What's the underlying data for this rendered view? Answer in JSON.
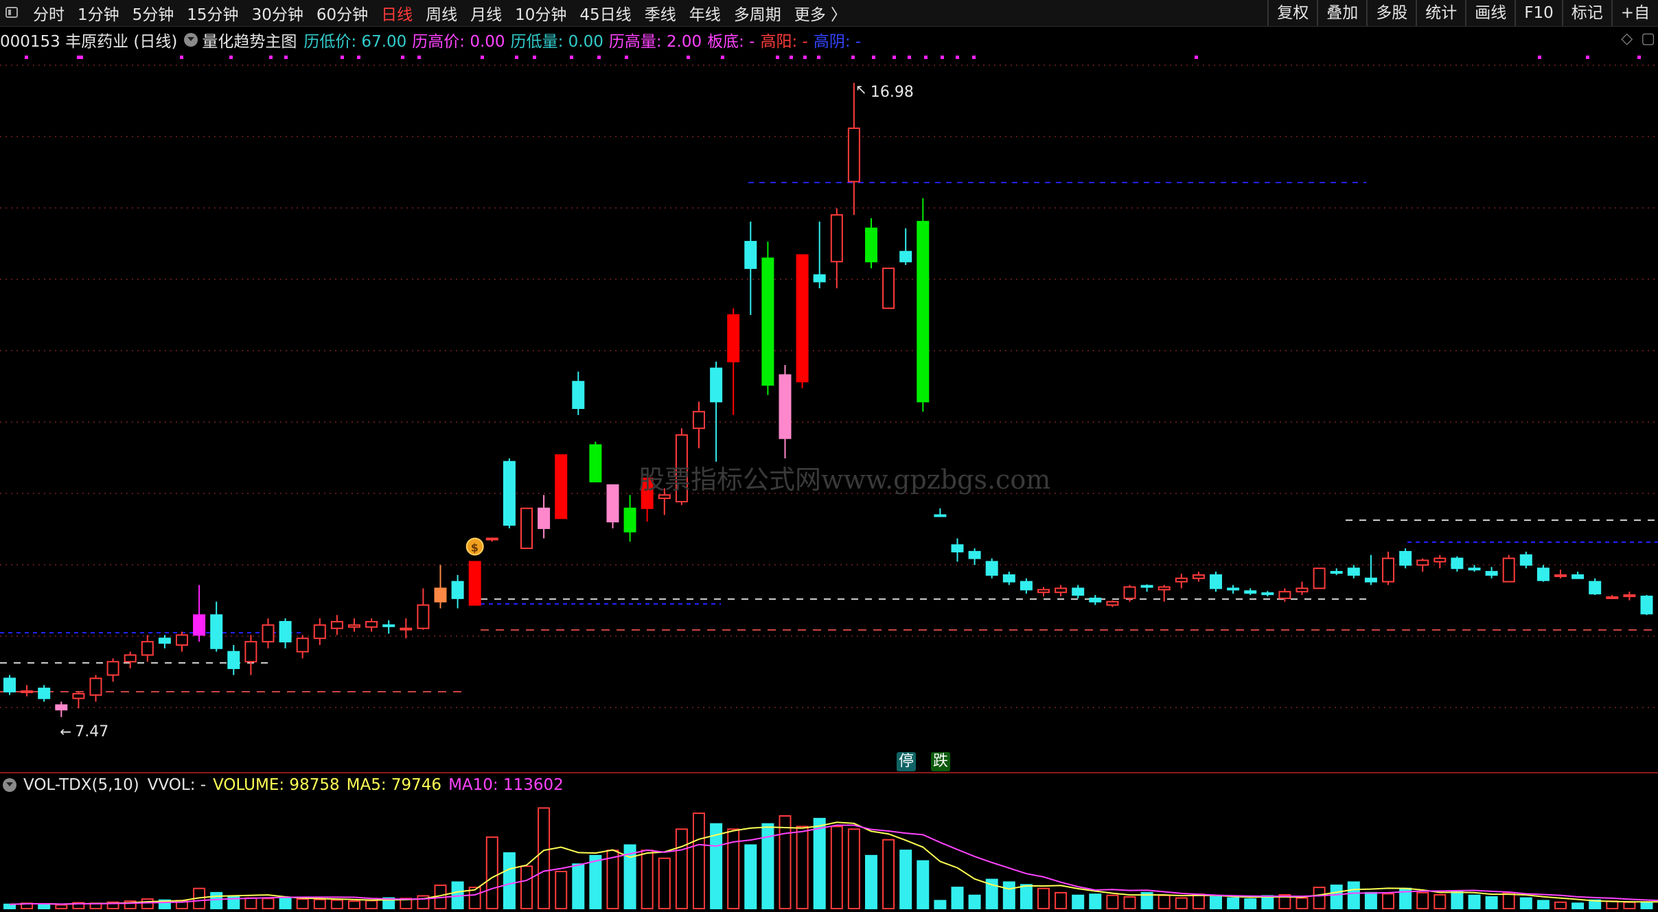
{
  "toolbar": {
    "periods": [
      "分时",
      "1分钟",
      "5分钟",
      "15分钟",
      "30分钟",
      "60分钟",
      "日线",
      "周线",
      "月线",
      "10分钟",
      "45日线",
      "季线",
      "年线",
      "多周期",
      "更多 〉"
    ],
    "active_period": "日线",
    "tools": [
      "复权",
      "叠加",
      "多股",
      "统计",
      "画线",
      "F10",
      "标记",
      "+自"
    ]
  },
  "info": {
    "code_name": "000153 丰原药业 (日线)",
    "indicator": "量化趋势主图",
    "fields": [
      {
        "label": "历低价: 67.00",
        "color": "#33cccc"
      },
      {
        "label": "历高价: 0.00",
        "color": "#ff44ff"
      },
      {
        "label": "历低量: 0.00",
        "color": "#33cccc"
      },
      {
        "label": "历高量: 2.00",
        "color": "#ff44ff"
      },
      {
        "label": "板底: -",
        "color": "#ff44ff"
      },
      {
        "label": "高阳: -",
        "color": "#ff3b3b"
      },
      {
        "label": "高阴: -",
        "color": "#3344ff"
      }
    ],
    "corner_icons": [
      "diamond-icon",
      "window-icon"
    ]
  },
  "price_labels": {
    "high": "16.98",
    "low": "7.47"
  },
  "tags": {
    "stop": "停",
    "down": "跌"
  },
  "watermark": "股票指标公式网www.gpzbgs.com",
  "volume": {
    "indicator": "VOL-TDX(5,10)",
    "vvol": "VVOL: -",
    "volume": "VOLUME: 98758",
    "ma5": "MA5: 79746",
    "ma10": "MA10: 113602"
  },
  "colors": {
    "up": "#ff3b3b",
    "down": "#33eeee",
    "strong_up": "#ff0000",
    "strong_down": "#00ee00",
    "pink": "#ff88cc",
    "ma5": "#ffff55",
    "ma10": "#ff44ff",
    "background": "#000000"
  },
  "chart_data": {
    "type": "candlestick",
    "price_range": [
      6.8,
      17.4
    ],
    "candles": [
      {
        "o": 8.05,
        "h": 8.1,
        "l": 7.8,
        "c": 7.85,
        "t": "down"
      },
      {
        "o": 7.85,
        "h": 7.95,
        "l": 7.78,
        "c": 7.86,
        "t": "up"
      },
      {
        "o": 7.9,
        "h": 7.95,
        "l": 7.7,
        "c": 7.75,
        "t": "down"
      },
      {
        "o": 7.58,
        "h": 7.7,
        "l": 7.47,
        "c": 7.65,
        "t": "pink"
      },
      {
        "o": 7.75,
        "h": 7.85,
        "l": 7.6,
        "c": 7.82,
        "t": "up"
      },
      {
        "o": 7.8,
        "h": 8.1,
        "l": 7.7,
        "c": 8.05,
        "t": "up"
      },
      {
        "o": 8.1,
        "h": 8.35,
        "l": 8.0,
        "c": 8.3,
        "t": "up"
      },
      {
        "o": 8.3,
        "h": 8.45,
        "l": 8.2,
        "c": 8.4,
        "t": "up"
      },
      {
        "o": 8.4,
        "h": 8.7,
        "l": 8.3,
        "c": 8.6,
        "t": "up"
      },
      {
        "o": 8.65,
        "h": 8.7,
        "l": 8.5,
        "c": 8.58,
        "t": "down"
      },
      {
        "o": 8.55,
        "h": 8.75,
        "l": 8.45,
        "c": 8.7,
        "t": "up"
      },
      {
        "o": 8.7,
        "h": 9.45,
        "l": 8.6,
        "c": 9.0,
        "t": "magenta"
      },
      {
        "o": 9.0,
        "h": 9.2,
        "l": 8.45,
        "c": 8.5,
        "t": "down"
      },
      {
        "o": 8.45,
        "h": 8.55,
        "l": 8.1,
        "c": 8.2,
        "t": "down"
      },
      {
        "o": 8.3,
        "h": 8.7,
        "l": 8.1,
        "c": 8.6,
        "t": "up"
      },
      {
        "o": 8.6,
        "h": 8.95,
        "l": 8.5,
        "c": 8.85,
        "t": "up"
      },
      {
        "o": 8.9,
        "h": 8.95,
        "l": 8.5,
        "c": 8.6,
        "t": "down"
      },
      {
        "o": 8.45,
        "h": 8.7,
        "l": 8.35,
        "c": 8.65,
        "t": "up"
      },
      {
        "o": 8.65,
        "h": 8.95,
        "l": 8.55,
        "c": 8.85,
        "t": "up"
      },
      {
        "o": 8.8,
        "h": 9.0,
        "l": 8.7,
        "c": 8.9,
        "t": "up"
      },
      {
        "o": 8.85,
        "h": 8.95,
        "l": 8.75,
        "c": 8.82,
        "t": "up"
      },
      {
        "o": 8.82,
        "h": 8.95,
        "l": 8.75,
        "c": 8.9,
        "t": "up"
      },
      {
        "o": 8.85,
        "h": 8.92,
        "l": 8.72,
        "c": 8.84,
        "t": "down"
      },
      {
        "o": 8.8,
        "h": 8.95,
        "l": 8.65,
        "c": 8.78,
        "t": "up"
      },
      {
        "o": 8.8,
        "h": 9.4,
        "l": 8.78,
        "c": 9.15,
        "t": "up"
      },
      {
        "o": 9.2,
        "h": 9.75,
        "l": 9.1,
        "c": 9.4,
        "t": "orange"
      },
      {
        "o": 9.5,
        "h": 9.6,
        "l": 9.1,
        "c": 9.25,
        "t": "down"
      },
      {
        "o": 9.15,
        "h": 9.8,
        "l": 9.15,
        "c": 9.8,
        "t": "strong_up"
      },
      {
        "o": 10.15,
        "h": 10.15,
        "l": 10.1,
        "c": 10.15,
        "t": "up"
      },
      {
        "o": 11.3,
        "h": 11.35,
        "l": 10.3,
        "c": 10.35,
        "t": "down"
      },
      {
        "o": 10.0,
        "h": 10.6,
        "l": 10.0,
        "c": 10.6,
        "t": "up"
      },
      {
        "o": 10.3,
        "h": 10.8,
        "l": 10.15,
        "c": 10.6,
        "t": "pink"
      },
      {
        "o": 10.45,
        "h": 11.4,
        "l": 10.45,
        "c": 11.4,
        "t": "strong_up"
      },
      {
        "o": 12.5,
        "h": 12.65,
        "l": 12.0,
        "c": 12.1,
        "t": "down"
      },
      {
        "o": 11.0,
        "h": 11.6,
        "l": 11.0,
        "c": 11.55,
        "t": "strong_down"
      },
      {
        "o": 10.95,
        "h": 10.95,
        "l": 10.3,
        "c": 10.4,
        "t": "pink"
      },
      {
        "o": 10.25,
        "h": 10.8,
        "l": 10.1,
        "c": 10.6,
        "t": "strong_down"
      },
      {
        "o": 10.6,
        "h": 11.05,
        "l": 10.4,
        "c": 11.05,
        "t": "strong_up"
      },
      {
        "o": 10.75,
        "h": 10.9,
        "l": 10.5,
        "c": 10.8,
        "t": "up"
      },
      {
        "o": 10.7,
        "h": 11.8,
        "l": 10.65,
        "c": 11.7,
        "t": "up"
      },
      {
        "o": 11.8,
        "h": 12.2,
        "l": 11.5,
        "c": 12.05,
        "t": "up"
      },
      {
        "o": 12.2,
        "h": 12.8,
        "l": 11.3,
        "c": 12.7,
        "t": "down"
      },
      {
        "o": 12.8,
        "h": 13.6,
        "l": 12.0,
        "c": 13.5,
        "t": "strong_up"
      },
      {
        "o": 14.2,
        "h": 14.9,
        "l": 13.5,
        "c": 14.6,
        "t": "down"
      },
      {
        "o": 14.35,
        "h": 14.6,
        "l": 12.3,
        "c": 12.45,
        "t": "strong_down"
      },
      {
        "o": 11.65,
        "h": 12.75,
        "l": 11.35,
        "c": 12.6,
        "t": "pink"
      },
      {
        "o": 12.5,
        "h": 14.4,
        "l": 12.4,
        "c": 14.4,
        "t": "strong_up"
      },
      {
        "o": 14.0,
        "h": 14.9,
        "l": 13.9,
        "c": 14.1,
        "t": "down"
      },
      {
        "o": 14.3,
        "h": 15.1,
        "l": 13.9,
        "c": 15.0,
        "t": "up"
      },
      {
        "o": 15.5,
        "h": 16.98,
        "l": 15.0,
        "c": 16.3,
        "t": "up"
      },
      {
        "o": 14.8,
        "h": 14.95,
        "l": 14.2,
        "c": 14.3,
        "t": "strong_down"
      },
      {
        "o": 13.6,
        "h": 14.2,
        "l": 13.6,
        "c": 14.2,
        "t": "up"
      },
      {
        "o": 14.45,
        "h": 14.8,
        "l": 14.25,
        "c": 14.3,
        "t": "down"
      },
      {
        "o": 14.9,
        "h": 15.25,
        "l": 12.05,
        "c": 12.2,
        "t": "strong_down"
      },
      {
        "o": 10.5,
        "h": 10.6,
        "l": 10.5,
        "c": 10.5,
        "t": "down"
      },
      {
        "o": 10.05,
        "h": 10.15,
        "l": 9.8,
        "c": 9.95,
        "t": "down"
      },
      {
        "o": 9.95,
        "h": 10.0,
        "l": 9.75,
        "c": 9.85,
        "t": "down"
      },
      {
        "o": 9.8,
        "h": 9.85,
        "l": 9.55,
        "c": 9.6,
        "t": "down"
      },
      {
        "o": 9.6,
        "h": 9.65,
        "l": 9.45,
        "c": 9.5,
        "t": "down"
      },
      {
        "o": 9.5,
        "h": 9.55,
        "l": 9.32,
        "c": 9.38,
        "t": "down"
      },
      {
        "o": 9.34,
        "h": 9.42,
        "l": 9.28,
        "c": 9.38,
        "t": "up"
      },
      {
        "o": 9.34,
        "h": 9.45,
        "l": 9.28,
        "c": 9.4,
        "t": "up"
      },
      {
        "o": 9.4,
        "h": 9.45,
        "l": 9.25,
        "c": 9.3,
        "t": "down"
      },
      {
        "o": 9.25,
        "h": 9.3,
        "l": 9.15,
        "c": 9.2,
        "t": "down"
      },
      {
        "o": 9.15,
        "h": 9.22,
        "l": 9.12,
        "c": 9.2,
        "t": "up"
      },
      {
        "o": 9.25,
        "h": 9.45,
        "l": 9.2,
        "c": 9.42,
        "t": "up"
      },
      {
        "o": 9.42,
        "h": 9.46,
        "l": 9.35,
        "c": 9.44,
        "t": "down"
      },
      {
        "o": 9.38,
        "h": 9.45,
        "l": 9.2,
        "c": 9.42,
        "t": "up"
      },
      {
        "o": 9.5,
        "h": 9.62,
        "l": 9.4,
        "c": 9.55,
        "t": "up"
      },
      {
        "o": 9.6,
        "h": 9.65,
        "l": 9.5,
        "c": 9.55,
        "t": "up"
      },
      {
        "o": 9.6,
        "h": 9.65,
        "l": 9.35,
        "c": 9.4,
        "t": "down"
      },
      {
        "o": 9.4,
        "h": 9.45,
        "l": 9.32,
        "c": 9.4,
        "t": "down"
      },
      {
        "o": 9.36,
        "h": 9.4,
        "l": 9.3,
        "c": 9.33,
        "t": "down"
      },
      {
        "o": 9.32,
        "h": 9.36,
        "l": 9.28,
        "c": 9.33,
        "t": "down"
      },
      {
        "o": 9.25,
        "h": 9.4,
        "l": 9.2,
        "c": 9.35,
        "t": "up"
      },
      {
        "o": 9.35,
        "h": 9.5,
        "l": 9.3,
        "c": 9.4,
        "t": "up"
      },
      {
        "o": 9.4,
        "h": 9.7,
        "l": 9.4,
        "c": 9.7,
        "t": "up"
      },
      {
        "o": 9.65,
        "h": 9.7,
        "l": 9.6,
        "c": 9.65,
        "t": "down"
      },
      {
        "o": 9.7,
        "h": 9.75,
        "l": 9.55,
        "c": 9.6,
        "t": "down"
      },
      {
        "o": 9.55,
        "h": 9.9,
        "l": 9.45,
        "c": 9.5,
        "t": "down"
      },
      {
        "o": 9.5,
        "h": 9.95,
        "l": 9.45,
        "c": 9.85,
        "t": "up"
      },
      {
        "o": 9.95,
        "h": 10.0,
        "l": 9.7,
        "c": 9.75,
        "t": "down"
      },
      {
        "o": 9.75,
        "h": 9.85,
        "l": 9.65,
        "c": 9.82,
        "t": "up"
      },
      {
        "o": 9.8,
        "h": 9.9,
        "l": 9.7,
        "c": 9.85,
        "t": "up"
      },
      {
        "o": 9.85,
        "h": 9.88,
        "l": 9.65,
        "c": 9.7,
        "t": "down"
      },
      {
        "o": 9.7,
        "h": 9.75,
        "l": 9.65,
        "c": 9.68,
        "t": "down"
      },
      {
        "o": 9.65,
        "h": 9.72,
        "l": 9.55,
        "c": 9.6,
        "t": "down"
      },
      {
        "o": 9.5,
        "h": 9.9,
        "l": 9.5,
        "c": 9.85,
        "t": "up"
      },
      {
        "o": 9.9,
        "h": 9.95,
        "l": 9.7,
        "c": 9.75,
        "t": "down"
      },
      {
        "o": 9.7,
        "h": 9.75,
        "l": 9.5,
        "c": 9.52,
        "t": "down"
      },
      {
        "o": 9.6,
        "h": 9.68,
        "l": 9.55,
        "c": 9.6,
        "t": "up"
      },
      {
        "o": 9.6,
        "h": 9.65,
        "l": 9.55,
        "c": 9.55,
        "t": "down"
      },
      {
        "o": 9.5,
        "h": 9.55,
        "l": 9.3,
        "c": 9.32,
        "t": "down"
      },
      {
        "o": 9.27,
        "h": 9.3,
        "l": 9.24,
        "c": 9.27,
        "t": "up"
      },
      {
        "o": 9.28,
        "h": 9.35,
        "l": 9.22,
        "c": 9.3,
        "t": "up"
      },
      {
        "o": 9.28,
        "h": 9.3,
        "l": 9.0,
        "c": 9.02,
        "t": "down"
      }
    ],
    "volumes": [
      8,
      10,
      9,
      7,
      11,
      10,
      12,
      14,
      18,
      16,
      15,
      38,
      30,
      22,
      20,
      19,
      20,
      18,
      17,
      16,
      14,
      15,
      20,
      19,
      24,
      44,
      50,
      40,
      135,
      105,
      80,
      190,
      70,
      84,
      100,
      110,
      120,
      110,
      95,
      150,
      180,
      160,
      150,
      120,
      160,
      175,
      155,
      170,
      155,
      150,
      100,
      130,
      110,
      90,
      15,
      40,
      25,
      55,
      50,
      45,
      38,
      30,
      25,
      27,
      25,
      22,
      30,
      25,
      20,
      27,
      22,
      20,
      18,
      24,
      26,
      20,
      40,
      44,
      50,
      30,
      28,
      38,
      30,
      26,
      32,
      25,
      22,
      30,
      20,
      15,
      12,
      10,
      16,
      14,
      12,
      11,
      10,
      9
    ],
    "vol_range": [
      0,
      210
    ]
  }
}
